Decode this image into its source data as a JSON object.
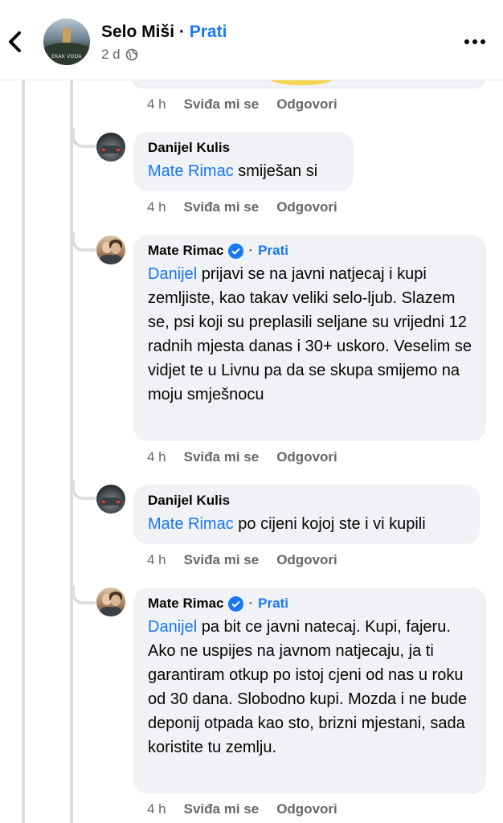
{
  "header": {
    "page_name": "Selo Miši",
    "separator": "·",
    "follow_label": "Prati",
    "time": "2 d",
    "avatar_text": "EKAK VODA",
    "privacy_icon": "globe-icon",
    "more_icon": "more-dots-icon",
    "back_icon": "chevron-left-icon"
  },
  "actions_labels": {
    "like": "Sviđa mi se",
    "reply": "Odgovori"
  },
  "top_action": {
    "time": "4 h"
  },
  "comments": [
    {
      "author": "Danijel Kulis",
      "verified": false,
      "mention": "Mate Rimac",
      "text": " smiješan si",
      "time": "4 h"
    },
    {
      "author": "Mate Rimac",
      "verified": true,
      "follow_label": "Prati",
      "separator": "·",
      "mention": "Danijel",
      "text": " prijavi se na javni natjecaj i kupi zemljiste, kao takav veliki selo-ljub. Slazem se, psi koji su preplasili seljane su vrijedni 12 radnih mjesta danas i 30+ uskoro. Veselim se vidjet te u Livnu pa da se skupa smijemo na moju smješnocu",
      "time": "4 h"
    },
    {
      "author": "Danijel Kulis",
      "verified": false,
      "mention": "Mate Rimac",
      "text": " po cijeni kojoj ste i vi kupili",
      "time": "4 h"
    },
    {
      "author": "Mate Rimac",
      "verified": true,
      "follow_label": "Prati",
      "separator": "·",
      "mention": "Danijel",
      "text": " pa bit ce javni natecaj. Kupi, fajeru. Ako ne uspijes na javnom natjecaju, ja ti garantiram otkup po istoj cjeni od nas u roku od 30 dana. Slobodno kupi. Mozda i ne bude deponij otpada kao sto, brizni mjestani, sada koristite tu zemlju.",
      "time": "4 h"
    }
  ],
  "colors": {
    "accent": "#1877f2",
    "bubble": "#f0f2f5",
    "muted": "#65676b"
  }
}
